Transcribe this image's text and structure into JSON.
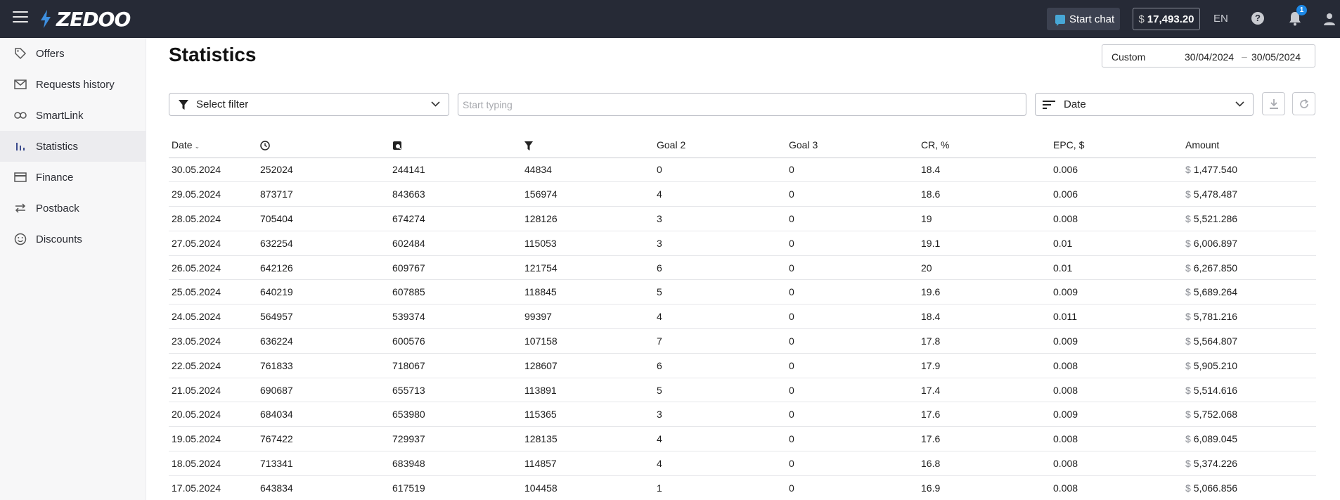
{
  "app": {
    "logo_text": "ZEDOO",
    "menu_icon": "hamburger-icon"
  },
  "topbar": {
    "chat_label": "Start chat",
    "balance_currency": "$",
    "balance_amount": "17,493.20",
    "language": "EN",
    "help_label": "?",
    "notifications_count": "1",
    "accent_color": "#1e88e5",
    "bar_color": "#262a36"
  },
  "sidebar": {
    "items": [
      {
        "label": "Offers",
        "icon": "tag-icon"
      },
      {
        "label": "Requests history",
        "icon": "mail-icon"
      },
      {
        "label": "SmartLink",
        "icon": "link-icon"
      },
      {
        "label": "Statistics",
        "icon": "bar-chart-icon",
        "active": true
      },
      {
        "label": "Finance",
        "icon": "credit-card-icon"
      },
      {
        "label": "Postback",
        "icon": "swap-icon"
      },
      {
        "label": "Discounts",
        "icon": "smiley-icon"
      }
    ]
  },
  "page": {
    "title": "Statistics",
    "daterange": {
      "label": "Custom",
      "from": "30/04/2024",
      "separator": "–",
      "to": "30/05/2024"
    },
    "filter": {
      "label": "Select filter"
    },
    "search": {
      "placeholder": "Start typing",
      "value": ""
    },
    "sort": {
      "label": "Date"
    }
  },
  "table": {
    "columns": {
      "date": "Date",
      "c1_icon": "clock-icon",
      "c2_icon": "click-icon",
      "c3_icon": "funnel-icon",
      "goal2": "Goal 2",
      "goal3": "Goal 3",
      "cr": "CR, %",
      "epc": "EPC, $",
      "amount": "Amount"
    },
    "currency": "$",
    "rows": [
      {
        "date": "30.05.2024",
        "c1": "252024",
        "c2": "244141",
        "c3": "44834",
        "goal2": "0",
        "goal3": "0",
        "cr": "18.4",
        "epc": "0.006",
        "amount": "1,477.540"
      },
      {
        "date": "29.05.2024",
        "c1": "873717",
        "c2": "843663",
        "c3": "156974",
        "goal2": "4",
        "goal3": "0",
        "cr": "18.6",
        "epc": "0.006",
        "amount": "5,478.487"
      },
      {
        "date": "28.05.2024",
        "c1": "705404",
        "c2": "674274",
        "c3": "128126",
        "goal2": "3",
        "goal3": "0",
        "cr": "19",
        "epc": "0.008",
        "amount": "5,521.286"
      },
      {
        "date": "27.05.2024",
        "c1": "632254",
        "c2": "602484",
        "c3": "115053",
        "goal2": "3",
        "goal3": "0",
        "cr": "19.1",
        "epc": "0.01",
        "amount": "6,006.897"
      },
      {
        "date": "26.05.2024",
        "c1": "642126",
        "c2": "609767",
        "c3": "121754",
        "goal2": "6",
        "goal3": "0",
        "cr": "20",
        "epc": "0.01",
        "amount": "6,267.850"
      },
      {
        "date": "25.05.2024",
        "c1": "640219",
        "c2": "607885",
        "c3": "118845",
        "goal2": "5",
        "goal3": "0",
        "cr": "19.6",
        "epc": "0.009",
        "amount": "5,689.264"
      },
      {
        "date": "24.05.2024",
        "c1": "564957",
        "c2": "539374",
        "c3": "99397",
        "goal2": "4",
        "goal3": "0",
        "cr": "18.4",
        "epc": "0.011",
        "amount": "5,781.216"
      },
      {
        "date": "23.05.2024",
        "c1": "636224",
        "c2": "600576",
        "c3": "107158",
        "goal2": "7",
        "goal3": "0",
        "cr": "17.8",
        "epc": "0.009",
        "amount": "5,564.807"
      },
      {
        "date": "22.05.2024",
        "c1": "761833",
        "c2": "718067",
        "c3": "128607",
        "goal2": "6",
        "goal3": "0",
        "cr": "17.9",
        "epc": "0.008",
        "amount": "5,905.210"
      },
      {
        "date": "21.05.2024",
        "c1": "690687",
        "c2": "655713",
        "c3": "113891",
        "goal2": "5",
        "goal3": "0",
        "cr": "17.4",
        "epc": "0.008",
        "amount": "5,514.616"
      },
      {
        "date": "20.05.2024",
        "c1": "684034",
        "c2": "653980",
        "c3": "115365",
        "goal2": "3",
        "goal3": "0",
        "cr": "17.6",
        "epc": "0.009",
        "amount": "5,752.068"
      },
      {
        "date": "19.05.2024",
        "c1": "767422",
        "c2": "729937",
        "c3": "128135",
        "goal2": "4",
        "goal3": "0",
        "cr": "17.6",
        "epc": "0.008",
        "amount": "6,089.045"
      },
      {
        "date": "18.05.2024",
        "c1": "713341",
        "c2": "683948",
        "c3": "114857",
        "goal2": "4",
        "goal3": "0",
        "cr": "16.8",
        "epc": "0.008",
        "amount": "5,374.226"
      },
      {
        "date": "17.05.2024",
        "c1": "643834",
        "c2": "617519",
        "c3": "104458",
        "goal2": "1",
        "goal3": "0",
        "cr": "16.9",
        "epc": "0.008",
        "amount": "5,066.856"
      }
    ]
  }
}
